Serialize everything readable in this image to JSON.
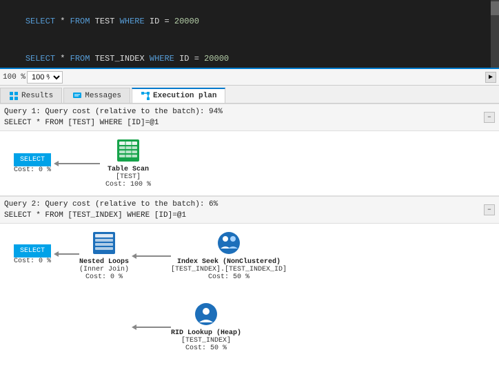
{
  "editor": {
    "line1": "SELECT * FROM TEST WHERE ID = 20000",
    "line2": "SELECT * FROM TEST_INDEX WHERE ID = 20000"
  },
  "toolbar": {
    "zoom_label": "100 %",
    "zoom_option": "100 %"
  },
  "tabs": [
    {
      "id": "results",
      "label": "Results",
      "active": false,
      "icon": "grid-icon"
    },
    {
      "id": "messages",
      "label": "Messages",
      "active": false,
      "icon": "message-icon"
    },
    {
      "id": "execution-plan",
      "label": "Execution plan",
      "active": true,
      "icon": "plan-icon"
    }
  ],
  "query1": {
    "header_line1": "Query 1: Query cost (relative to the batch): 94%",
    "header_line2": "SELECT * FROM [TEST] WHERE [ID]=@1",
    "select_label": "SELECT",
    "select_cost": "Cost: 0 %",
    "table_scan_label": "Table Scan",
    "table_scan_table": "[TEST]",
    "table_scan_cost": "Cost: 100 %"
  },
  "query2": {
    "header_line1": "Query 2: Query cost (relative to the batch): 6%",
    "header_line2": "SELECT * FROM [TEST_INDEX] WHERE [ID]=@1",
    "select_label": "SELECT",
    "select_cost": "Cost: 0 %",
    "nested_loops_label": "Nested Loops",
    "nested_loops_sub": "(Inner Join)",
    "nested_loops_cost": "Cost: 0 %",
    "index_seek_label": "Index Seek (NonClustered)",
    "index_seek_table": "[TEST_INDEX].[TEST_INDEX_ID]",
    "index_seek_cost": "Cost: 50 %",
    "rid_lookup_label": "RID Lookup (Heap)",
    "rid_lookup_table": "[TEST_INDEX]",
    "rid_lookup_cost": "Cost: 50 %"
  }
}
